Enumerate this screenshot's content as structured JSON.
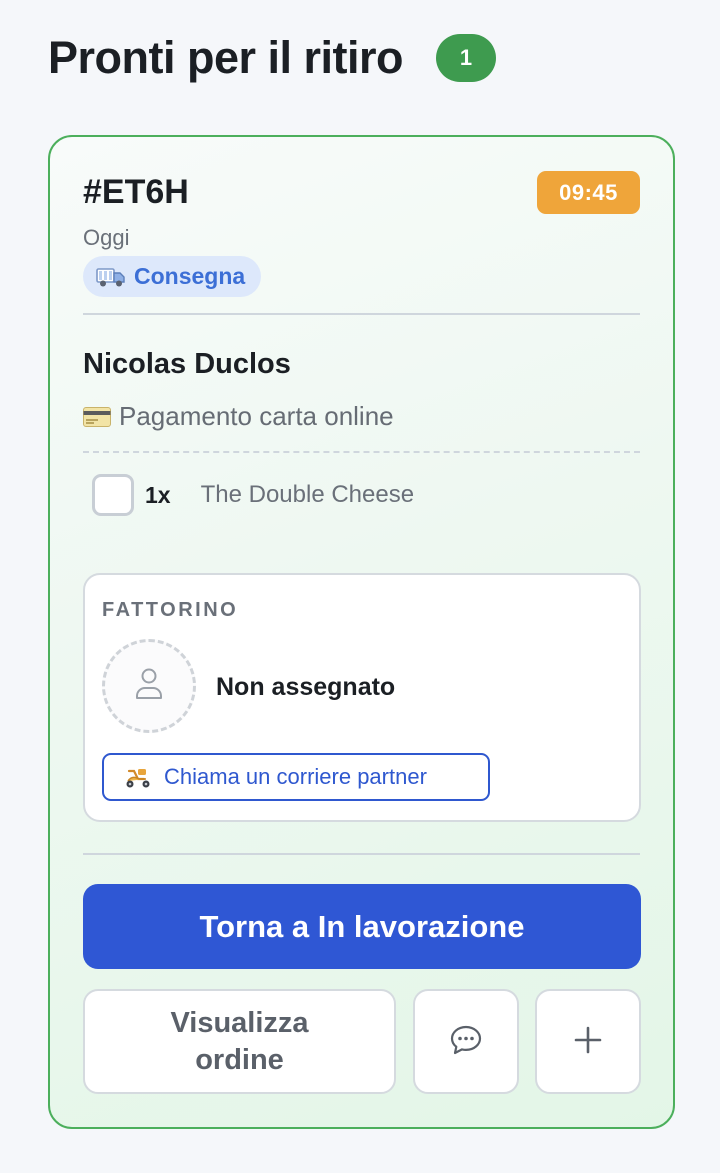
{
  "header": {
    "title": "Pronti per il ritiro",
    "count": "1"
  },
  "order": {
    "id": "#ET6H",
    "time": "09:45",
    "day": "Oggi",
    "type_label": "Consegna",
    "customer_name": "Nicolas Duclos",
    "payment_label": "Pagamento carta online",
    "items": [
      {
        "qty": "1x",
        "name": "The Double Cheese"
      }
    ]
  },
  "courier": {
    "title": "FATTORINO",
    "status": "Non assegnato",
    "call_label": "Chiama un corriere partner"
  },
  "actions": {
    "primary_label": "Torna a In lavorazione",
    "view_label": "Visualizza ordine"
  },
  "icons": {
    "type": "truck-icon",
    "payment": "credit-card-icon",
    "avatar": "user-icon",
    "call": "scooter-icon",
    "chat": "chat-bubble-icon",
    "add": "plus-icon"
  },
  "colors": {
    "accent_green": "#3e9b4f",
    "time_badge": "#efa53a",
    "primary_blue": "#2f57d4",
    "chip_blue": "#3c6fd6"
  }
}
